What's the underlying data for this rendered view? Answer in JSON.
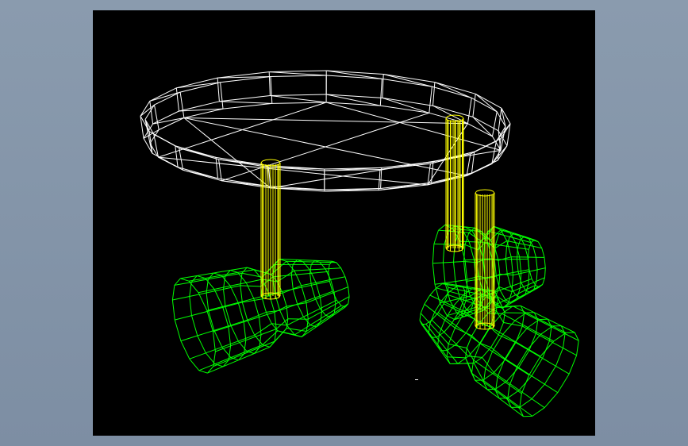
{
  "viewport": {
    "background": "#000000",
    "window_background": "#8a9bae"
  },
  "model": {
    "parts": [
      {
        "name": "ceiling-plate",
        "color": "#ffffff",
        "render": "wireframe"
      },
      {
        "name": "rods",
        "count": 3,
        "color": "#ffff00",
        "render": "wireframe"
      },
      {
        "name": "spot-heads",
        "count": 3,
        "color": "#00ff00",
        "render": "wireframe"
      }
    ]
  },
  "colors": {
    "plate": "#ffffff",
    "rod": "#ffff00",
    "head": "#00ff00"
  }
}
